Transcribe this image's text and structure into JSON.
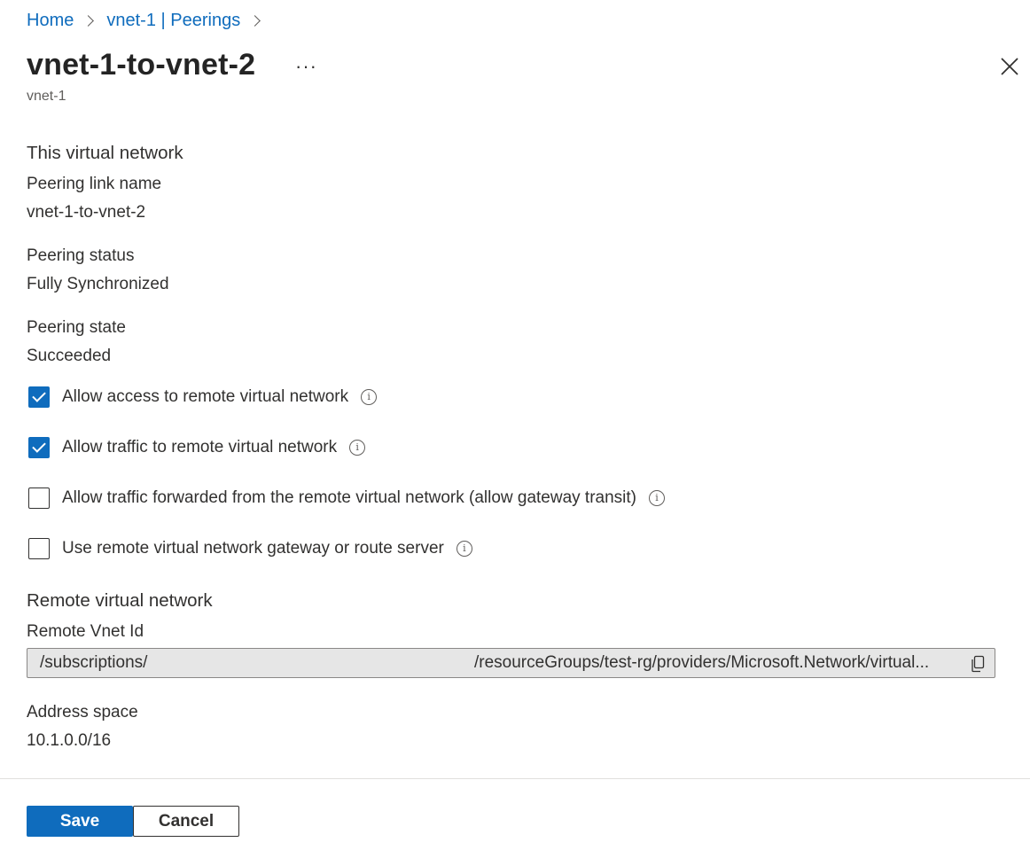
{
  "breadcrumb": {
    "items": [
      {
        "label": "Home"
      },
      {
        "label": "vnet-1 | Peerings"
      }
    ]
  },
  "header": {
    "title": "vnet-1-to-vnet-2",
    "more_label": "···",
    "subtitle": "vnet-1",
    "close_icon": "close-icon"
  },
  "this_network": {
    "heading": "This virtual network",
    "link_name_label": "Peering link name",
    "link_name_value": "vnet-1-to-vnet-2",
    "status_label": "Peering status",
    "status_value": "Fully Synchronized",
    "state_label": "Peering state",
    "state_value": "Succeeded"
  },
  "options": [
    {
      "label": "Allow access to remote virtual network",
      "checked": true
    },
    {
      "label": "Allow traffic to remote virtual network",
      "checked": true
    },
    {
      "label": "Allow traffic forwarded from the remote virtual network (allow gateway transit)",
      "checked": false
    },
    {
      "label": "Use remote virtual network gateway or route server",
      "checked": false
    }
  ],
  "info_glyph": "i",
  "remote_network": {
    "heading": "Remote virtual network",
    "vnet_id_label": "Remote Vnet Id",
    "vnet_id_prefix": "/subscriptions/",
    "vnet_id_suffix": "/resourceGroups/test-rg/providers/Microsoft.Network/virtual...",
    "address_space_label": "Address space",
    "address_space_value": "10.1.0.0/16"
  },
  "footer": {
    "save_label": "Save",
    "cancel_label": "Cancel"
  },
  "colors": {
    "accent": "#0f6cbd",
    "text": "#323130",
    "field_bg": "#e6e6e6"
  }
}
